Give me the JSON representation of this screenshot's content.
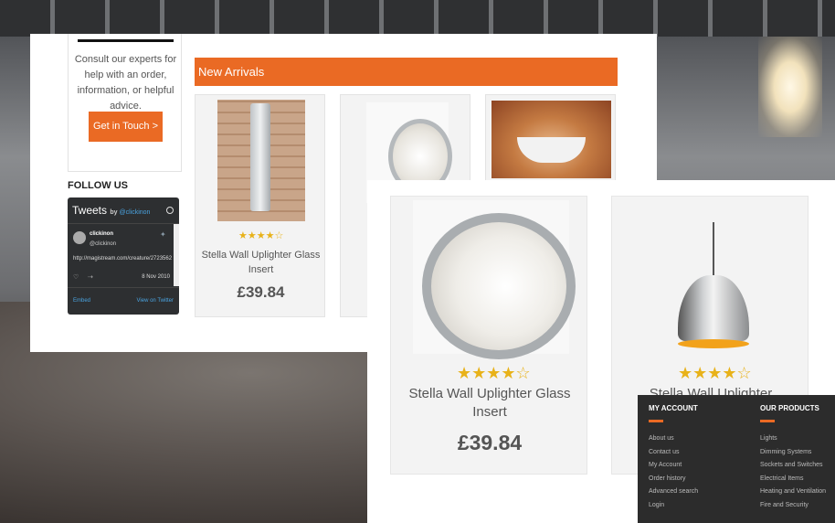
{
  "contact": {
    "text": "Consult our experts for help with an order, information, or helpful advice.",
    "button": "Get in Touch >"
  },
  "follow_title": "FOLLOW US",
  "twitter": {
    "title": "Tweets",
    "by": "by",
    "handle": "@clickinon",
    "user_name": "clickinon",
    "user_handle": "@clickinon",
    "link": "http://magistream.com/creature/2723562",
    "date": "8 Nov 2010",
    "embed": "Embed",
    "view": "View on Twitter"
  },
  "section_title": "New Arrivals",
  "products_small": [
    {
      "name": "Stella Wall Uplighter Glass Insert",
      "price": "£39.84",
      "rating": 4.5
    }
  ],
  "products_big": [
    {
      "name": "Stella Wall Uplighter Glass Insert",
      "price": "£39.84",
      "rating": 4.5
    },
    {
      "name": "Stella Wall Uplighter",
      "rating": 4.5
    }
  ],
  "footer": {
    "account_title": "MY ACCOUNT",
    "account_links": [
      "About us",
      "Contact us",
      "My Account",
      "Order history",
      "Advanced search",
      "Login"
    ],
    "products_title": "OUR PRODUCTS",
    "products_links": [
      "Lights",
      "Dimming Systems",
      "Sockets and Switches",
      "Electrical Items",
      "Heating and Ventilation",
      "Fire and Security"
    ]
  },
  "colors": {
    "accent": "#ea6a24",
    "star": "#e8b21a",
    "footer_bg": "#2c2c2c"
  }
}
